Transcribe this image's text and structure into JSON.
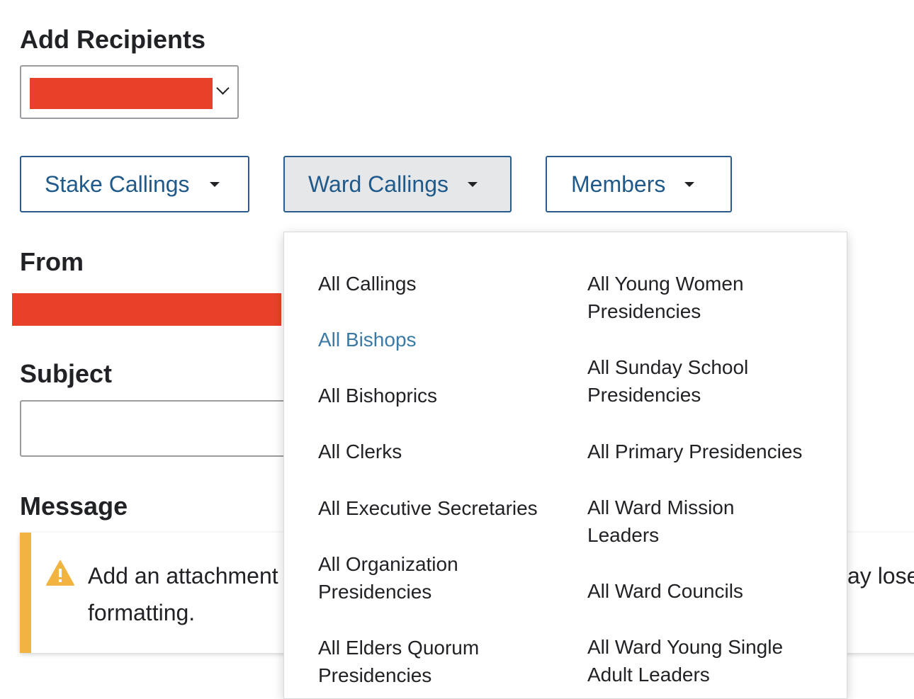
{
  "add_recipients": {
    "heading": "Add Recipients"
  },
  "buttons": {
    "stake": "Stake Callings",
    "ward": "Ward Callings",
    "members": "Members"
  },
  "from": {
    "heading": "From"
  },
  "subject": {
    "heading": "Subject",
    "value": ""
  },
  "message": {
    "heading": "Message",
    "notice_line1_left": "Add an attachment",
    "notice_line1_right": "ay lose",
    "notice_line2": "formatting."
  },
  "menu": {
    "left_items": [
      {
        "label": "All Callings"
      },
      {
        "label": "All Bishops"
      },
      {
        "label": "All Bishoprics"
      },
      {
        "label": "All Clerks"
      },
      {
        "label": "All Executive Secretaries"
      },
      {
        "label": "All Organization\nPresidencies"
      },
      {
        "label": "All Elders Quorum\nPresidencies"
      }
    ],
    "right_items": [
      {
        "label": "All Young Women\nPresidencies"
      },
      {
        "label": "All Sunday School\nPresidencies"
      },
      {
        "label": "All Primary Presidencies"
      },
      {
        "label": "All Ward Mission\nLeaders"
      },
      {
        "label": "All Ward Councils"
      },
      {
        "label": "All Ward Young Single\nAdult Leaders"
      }
    ]
  },
  "colors": {
    "accent": "#1f5a8a",
    "highlight": "#3c7aa6",
    "redaction": "#e8412a",
    "warning": "#f2b441"
  },
  "icons": {
    "dropdown": "chevron-down-icon",
    "caret": "caret-down-icon",
    "warning": "warning-triangle-icon"
  }
}
